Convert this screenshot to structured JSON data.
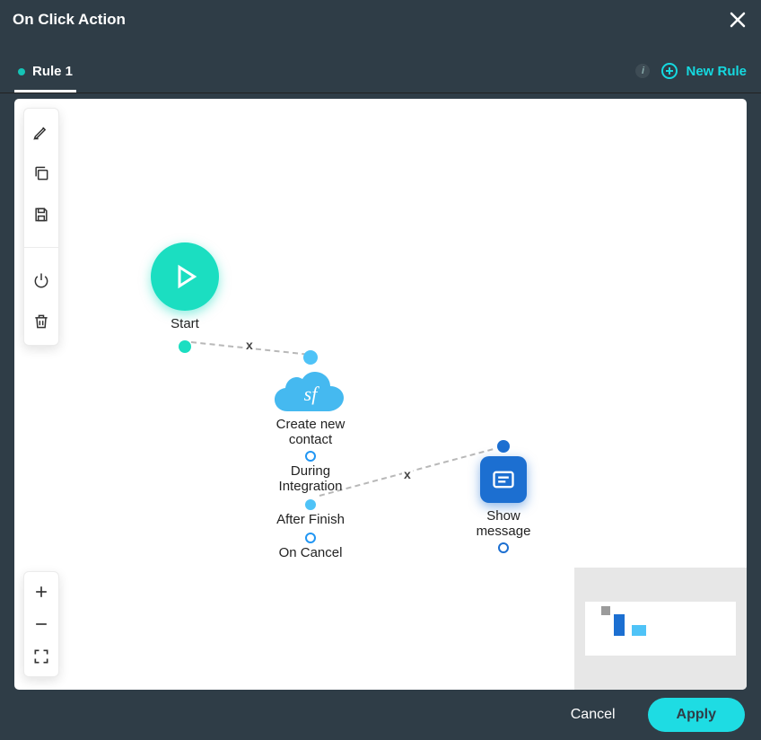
{
  "title": "On Click Action",
  "tabs": {
    "rule1": "Rule 1"
  },
  "newRule": "New Rule",
  "nodes": {
    "start": "Start",
    "createContact": "Create new contact",
    "duringIntegration": "During\nIntegration",
    "afterFinish": "After Finish",
    "onCancel": "On Cancel",
    "showMessage": "Show message",
    "sfGlyph": "sf"
  },
  "footer": {
    "cancel": "Cancel",
    "apply": "Apply"
  },
  "connectorDelete": "x"
}
